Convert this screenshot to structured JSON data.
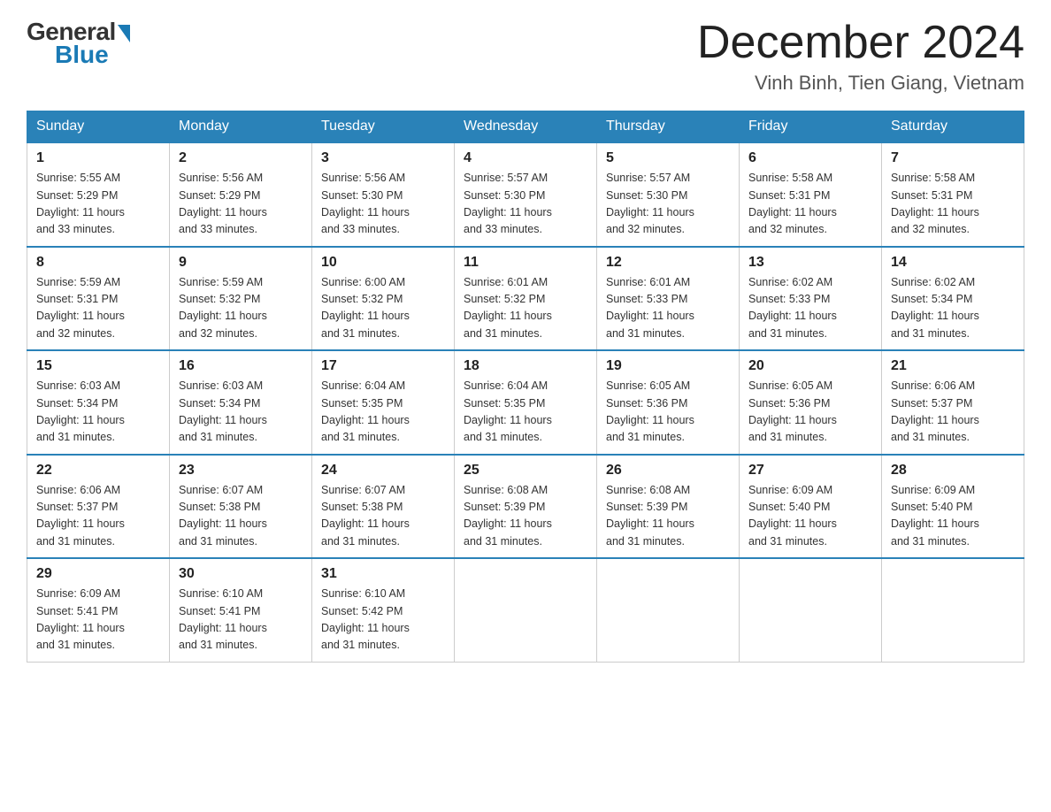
{
  "header": {
    "logo_general": "General",
    "logo_blue": "Blue",
    "month_title": "December 2024",
    "location": "Vinh Binh, Tien Giang, Vietnam"
  },
  "weekdays": [
    "Sunday",
    "Monday",
    "Tuesday",
    "Wednesday",
    "Thursday",
    "Friday",
    "Saturday"
  ],
  "weeks": [
    [
      {
        "day": "1",
        "sunrise": "5:55 AM",
        "sunset": "5:29 PM",
        "daylight": "11 hours and 33 minutes."
      },
      {
        "day": "2",
        "sunrise": "5:56 AM",
        "sunset": "5:29 PM",
        "daylight": "11 hours and 33 minutes."
      },
      {
        "day": "3",
        "sunrise": "5:56 AM",
        "sunset": "5:30 PM",
        "daylight": "11 hours and 33 minutes."
      },
      {
        "day": "4",
        "sunrise": "5:57 AM",
        "sunset": "5:30 PM",
        "daylight": "11 hours and 33 minutes."
      },
      {
        "day": "5",
        "sunrise": "5:57 AM",
        "sunset": "5:30 PM",
        "daylight": "11 hours and 32 minutes."
      },
      {
        "day": "6",
        "sunrise": "5:58 AM",
        "sunset": "5:31 PM",
        "daylight": "11 hours and 32 minutes."
      },
      {
        "day": "7",
        "sunrise": "5:58 AM",
        "sunset": "5:31 PM",
        "daylight": "11 hours and 32 minutes."
      }
    ],
    [
      {
        "day": "8",
        "sunrise": "5:59 AM",
        "sunset": "5:31 PM",
        "daylight": "11 hours and 32 minutes."
      },
      {
        "day": "9",
        "sunrise": "5:59 AM",
        "sunset": "5:32 PM",
        "daylight": "11 hours and 32 minutes."
      },
      {
        "day": "10",
        "sunrise": "6:00 AM",
        "sunset": "5:32 PM",
        "daylight": "11 hours and 31 minutes."
      },
      {
        "day": "11",
        "sunrise": "6:01 AM",
        "sunset": "5:32 PM",
        "daylight": "11 hours and 31 minutes."
      },
      {
        "day": "12",
        "sunrise": "6:01 AM",
        "sunset": "5:33 PM",
        "daylight": "11 hours and 31 minutes."
      },
      {
        "day": "13",
        "sunrise": "6:02 AM",
        "sunset": "5:33 PM",
        "daylight": "11 hours and 31 minutes."
      },
      {
        "day": "14",
        "sunrise": "6:02 AM",
        "sunset": "5:34 PM",
        "daylight": "11 hours and 31 minutes."
      }
    ],
    [
      {
        "day": "15",
        "sunrise": "6:03 AM",
        "sunset": "5:34 PM",
        "daylight": "11 hours and 31 minutes."
      },
      {
        "day": "16",
        "sunrise": "6:03 AM",
        "sunset": "5:34 PM",
        "daylight": "11 hours and 31 minutes."
      },
      {
        "day": "17",
        "sunrise": "6:04 AM",
        "sunset": "5:35 PM",
        "daylight": "11 hours and 31 minutes."
      },
      {
        "day": "18",
        "sunrise": "6:04 AM",
        "sunset": "5:35 PM",
        "daylight": "11 hours and 31 minutes."
      },
      {
        "day": "19",
        "sunrise": "6:05 AM",
        "sunset": "5:36 PM",
        "daylight": "11 hours and 31 minutes."
      },
      {
        "day": "20",
        "sunrise": "6:05 AM",
        "sunset": "5:36 PM",
        "daylight": "11 hours and 31 minutes."
      },
      {
        "day": "21",
        "sunrise": "6:06 AM",
        "sunset": "5:37 PM",
        "daylight": "11 hours and 31 minutes."
      }
    ],
    [
      {
        "day": "22",
        "sunrise": "6:06 AM",
        "sunset": "5:37 PM",
        "daylight": "11 hours and 31 minutes."
      },
      {
        "day": "23",
        "sunrise": "6:07 AM",
        "sunset": "5:38 PM",
        "daylight": "11 hours and 31 minutes."
      },
      {
        "day": "24",
        "sunrise": "6:07 AM",
        "sunset": "5:38 PM",
        "daylight": "11 hours and 31 minutes."
      },
      {
        "day": "25",
        "sunrise": "6:08 AM",
        "sunset": "5:39 PM",
        "daylight": "11 hours and 31 minutes."
      },
      {
        "day": "26",
        "sunrise": "6:08 AM",
        "sunset": "5:39 PM",
        "daylight": "11 hours and 31 minutes."
      },
      {
        "day": "27",
        "sunrise": "6:09 AM",
        "sunset": "5:40 PM",
        "daylight": "11 hours and 31 minutes."
      },
      {
        "day": "28",
        "sunrise": "6:09 AM",
        "sunset": "5:40 PM",
        "daylight": "11 hours and 31 minutes."
      }
    ],
    [
      {
        "day": "29",
        "sunrise": "6:09 AM",
        "sunset": "5:41 PM",
        "daylight": "11 hours and 31 minutes."
      },
      {
        "day": "30",
        "sunrise": "6:10 AM",
        "sunset": "5:41 PM",
        "daylight": "11 hours and 31 minutes."
      },
      {
        "day": "31",
        "sunrise": "6:10 AM",
        "sunset": "5:42 PM",
        "daylight": "11 hours and 31 minutes."
      },
      null,
      null,
      null,
      null
    ]
  ],
  "labels": {
    "sunrise": "Sunrise:",
    "sunset": "Sunset:",
    "daylight": "Daylight:"
  }
}
